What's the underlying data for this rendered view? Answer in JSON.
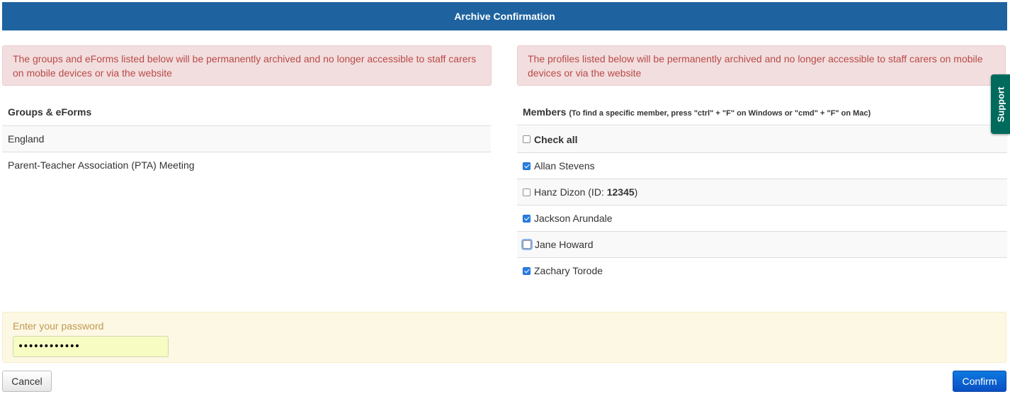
{
  "header": {
    "title": "Archive Confirmation"
  },
  "alerts": {
    "left": "The groups and eForms listed below will be permanently archived and no longer accessible to staff carers on mobile devices or via the website",
    "right": "The profiles listed below will be permanently archived and no longer accessible to staff carers on mobile devices or via the website"
  },
  "groups": {
    "heading": "Groups & eForms",
    "items": [
      "England",
      "Parent-Teacher Association (PTA) Meeting"
    ]
  },
  "members": {
    "heading": "Members",
    "hint": "(To find a specific member, press \"ctrl\" + \"F\" on Windows or \"cmd\" + \"F\" on Mac)",
    "check_all": "Check all",
    "items": [
      {
        "name": "Allan Stevens",
        "checked": true
      },
      {
        "name": "Hanz Dizon",
        "id_prefix": "(ID: ",
        "id": "12345",
        "id_suffix": ")",
        "checked": false
      },
      {
        "name": "Jackson Arundale",
        "checked": true
      },
      {
        "name": "Jane Howard",
        "checked": false
      },
      {
        "name": "Zachary Torode",
        "checked": true
      }
    ]
  },
  "support": {
    "label": "Support"
  },
  "password": {
    "label": "Enter your password",
    "value": "••••••••••••"
  },
  "buttons": {
    "cancel": "Cancel",
    "confirm": "Confirm"
  },
  "colors": {
    "header_bg": "#1e63a0",
    "alert_bg": "#f2dede",
    "alert_text": "#b94a48",
    "support_bg": "#006b5c",
    "password_box_bg": "#fcf8e3",
    "confirm_bg": "#0a4fc4"
  }
}
